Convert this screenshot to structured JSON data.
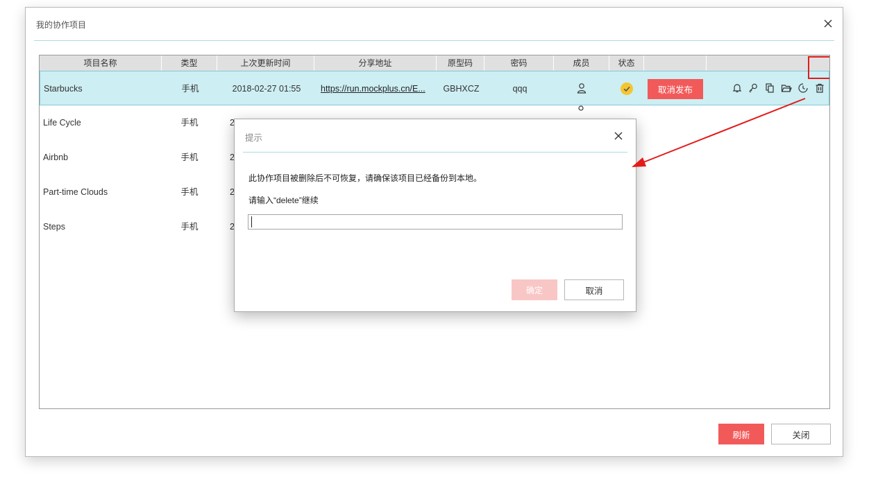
{
  "window": {
    "title": "我的协作项目"
  },
  "table": {
    "columns": [
      "项目名称",
      "类型",
      "上次更新时间",
      "分享地址",
      "原型码",
      "密码",
      "成员",
      "状态",
      ""
    ],
    "rows": [
      {
        "name": "Starbucks",
        "type": "手机",
        "updated": "2018-02-27 01:55",
        "url": "https://run.mockplus.cn/E...",
        "code": "GBHXCZ",
        "password": "qqq",
        "selected": true
      },
      {
        "name": "Life Cycle",
        "type": "手机",
        "updated": "2"
      },
      {
        "name": "Airbnb",
        "type": "手机",
        "updated": "2"
      },
      {
        "name": "Part-time Clouds",
        "type": "手机",
        "updated": "2"
      },
      {
        "name": "Steps",
        "type": "手机",
        "updated": "2"
      }
    ],
    "unpublish_label": "取消发布",
    "row_icons": [
      "bell-icon",
      "key-icon",
      "copy-icon",
      "folder-icon",
      "history-icon",
      "trash-icon"
    ]
  },
  "footer": {
    "refresh_label": "刷新",
    "close_label": "关闭"
  },
  "dialog": {
    "title": "提示",
    "message": "此协作项目被删除后不可恢复，请确保该项目已经备份到本地。",
    "prompt": "请输入“delete”继续",
    "input_value": "",
    "ok_label": "确定",
    "cancel_label": "取消"
  },
  "colors": {
    "accent_red": "#f25a5a",
    "selected_row": "#cdeef3",
    "separator": "#a9dbe4",
    "status_yellow": "#f5c531",
    "annotation_red": "#e21b1b"
  }
}
